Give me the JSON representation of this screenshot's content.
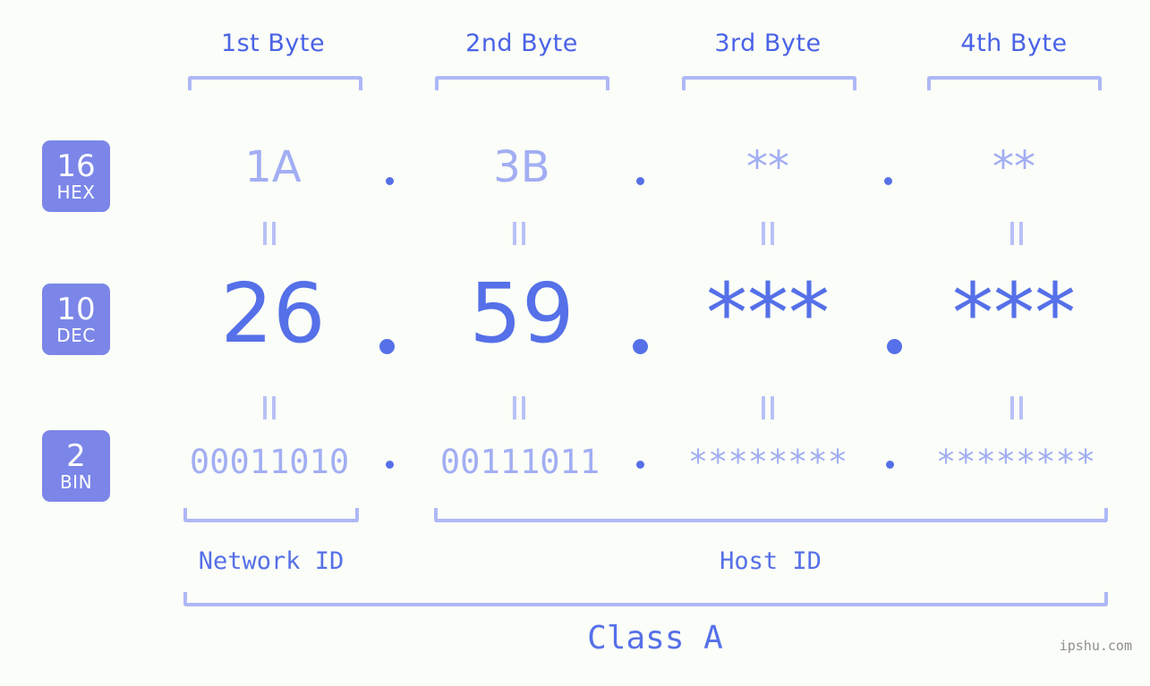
{
  "background_color": "#fbfdf8",
  "accent_dark": "#5570e8",
  "accent_light": "#a2aef3",
  "badge_color": "#7b86e8",
  "bracket_color": "#aeb8f7",
  "headers": [
    {
      "label": "1st Byte"
    },
    {
      "label": "2nd Byte"
    },
    {
      "label": "3rd Byte"
    },
    {
      "label": "4th Byte"
    }
  ],
  "bases": [
    {
      "num": "16",
      "abbr": "HEX"
    },
    {
      "num": "10",
      "abbr": "DEC"
    },
    {
      "num": "2",
      "abbr": "BIN"
    }
  ],
  "rows": {
    "hex": {
      "values": [
        "1A",
        "3B",
        "**",
        "**"
      ]
    },
    "dec": {
      "values": [
        "26",
        "59",
        "***",
        "***"
      ]
    },
    "bin": {
      "values": [
        "00011010",
        "00111011",
        "********",
        "********"
      ]
    }
  },
  "separator": ".",
  "equals_glyph": "=",
  "footer": {
    "network_id": "Network ID",
    "host_id": "Host ID",
    "class_label": "Class A"
  },
  "watermark": "ipshu.com"
}
